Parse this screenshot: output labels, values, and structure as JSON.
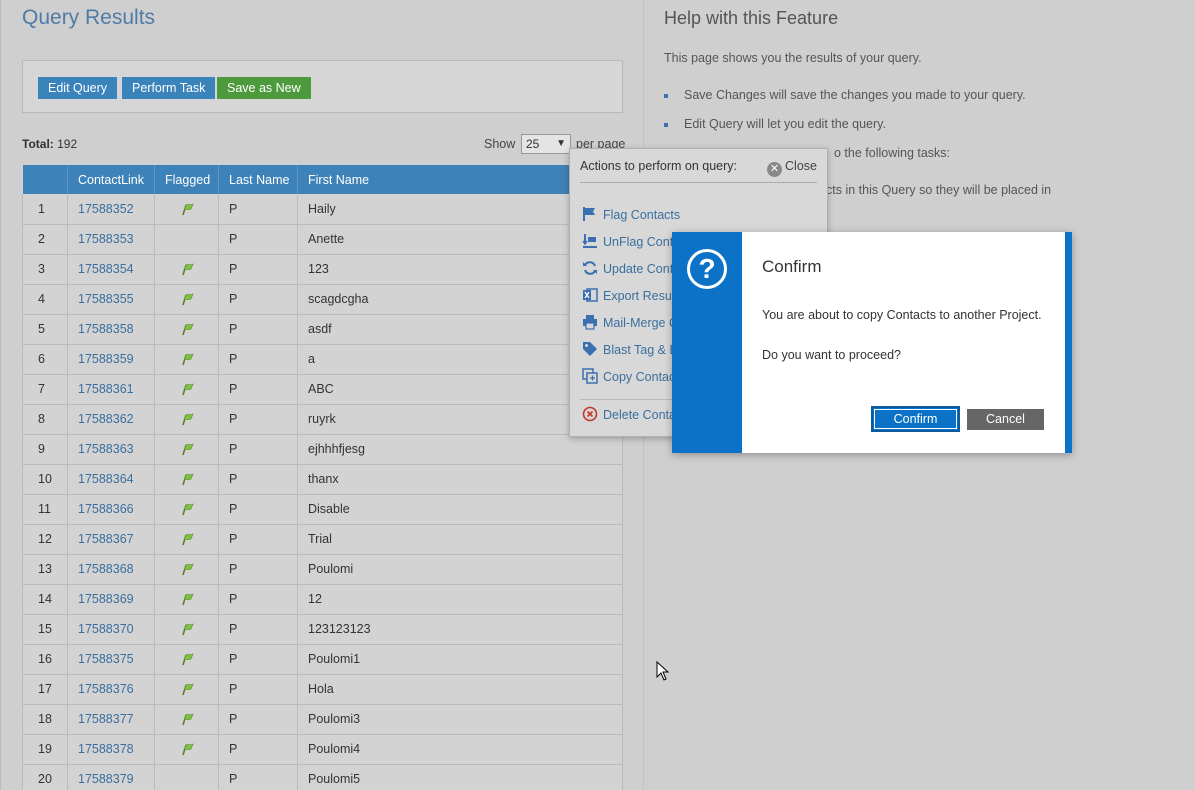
{
  "page": {
    "title": "Query Results",
    "help_title": "Help with this Feature"
  },
  "toolbar": {
    "edit_query": "Edit Query",
    "perform_task": "Perform Task",
    "save_as_new": "Save as New"
  },
  "summary": {
    "total_label": "Total:",
    "total_value": "192",
    "show_label": "Show",
    "per_page_value": "25",
    "per_page_label": "per page"
  },
  "table": {
    "headers": [
      "",
      "ContactLink",
      "Flagged",
      "Last Name",
      "First Name"
    ],
    "rows": [
      {
        "n": "1",
        "link": "17588352",
        "flagged": true,
        "last": "P",
        "first": "Haily"
      },
      {
        "n": "2",
        "link": "17588353",
        "flagged": false,
        "last": "P",
        "first": "Anette"
      },
      {
        "n": "3",
        "link": "17588354",
        "flagged": true,
        "last": "P",
        "first": "123"
      },
      {
        "n": "4",
        "link": "17588355",
        "flagged": true,
        "last": "P",
        "first": "scagdcgha"
      },
      {
        "n": "5",
        "link": "17588358",
        "flagged": true,
        "last": "P",
        "first": "asdf"
      },
      {
        "n": "6",
        "link": "17588359",
        "flagged": true,
        "last": "P",
        "first": "a"
      },
      {
        "n": "7",
        "link": "17588361",
        "flagged": true,
        "last": "P",
        "first": "ABC"
      },
      {
        "n": "8",
        "link": "17588362",
        "flagged": true,
        "last": "P",
        "first": "ruyrk"
      },
      {
        "n": "9",
        "link": "17588363",
        "flagged": true,
        "last": "P",
        "first": "ejhhhfjesg"
      },
      {
        "n": "10",
        "link": "17588364",
        "flagged": true,
        "last": "P",
        "first": "thanx"
      },
      {
        "n": "11",
        "link": "17588366",
        "flagged": true,
        "last": "P",
        "first": "Disable"
      },
      {
        "n": "12",
        "link": "17588367",
        "flagged": true,
        "last": "P",
        "first": "Trial"
      },
      {
        "n": "13",
        "link": "17588368",
        "flagged": true,
        "last": "P",
        "first": "Poulomi"
      },
      {
        "n": "14",
        "link": "17588369",
        "flagged": true,
        "last": "P",
        "first": "12"
      },
      {
        "n": "15",
        "link": "17588370",
        "flagged": true,
        "last": "P",
        "first": "123123123"
      },
      {
        "n": "16",
        "link": "17588375",
        "flagged": true,
        "last": "P",
        "first": "Poulomi1"
      },
      {
        "n": "17",
        "link": "17588376",
        "flagged": true,
        "last": "P",
        "first": "Hola"
      },
      {
        "n": "18",
        "link": "17588377",
        "flagged": true,
        "last": "P",
        "first": "Poulomi3"
      },
      {
        "n": "19",
        "link": "17588378",
        "flagged": true,
        "last": "P",
        "first": "Poulomi4"
      },
      {
        "n": "20",
        "link": "17588379",
        "flagged": false,
        "last": "P",
        "first": "Poulomi5"
      }
    ]
  },
  "help": {
    "intro": "This page shows you the results of your query.",
    "bullets": [
      "Save Changes will save the changes you made to your query.",
      "Edit Query will let you edit the query.",
      "o the following tasks:",
      "cts in this Query so they will be placed in"
    ]
  },
  "actions": {
    "title": "Actions to perform on query:",
    "close": "Close",
    "items": [
      {
        "label": "Flag Contacts",
        "icon": "flag-icon"
      },
      {
        "label": "UnFlag Cont",
        "icon": "unflag-icon"
      },
      {
        "label": "Update Cont",
        "icon": "refresh-icon"
      },
      {
        "label": "Export Resul",
        "icon": "excel-icon"
      },
      {
        "label": "Mail-Merge C",
        "icon": "printer-icon"
      },
      {
        "label": "Blast Tag & E",
        "icon": "tag-icon"
      },
      {
        "label": "Copy Contac",
        "icon": "copy-icon"
      },
      {
        "label": "Delete Conta",
        "icon": "delete-icon"
      }
    ]
  },
  "modal": {
    "title": "Confirm",
    "message": "You are about to copy Contacts to another Project.",
    "question": "Do you want to proceed?",
    "confirm": "Confirm",
    "cancel": "Cancel"
  }
}
